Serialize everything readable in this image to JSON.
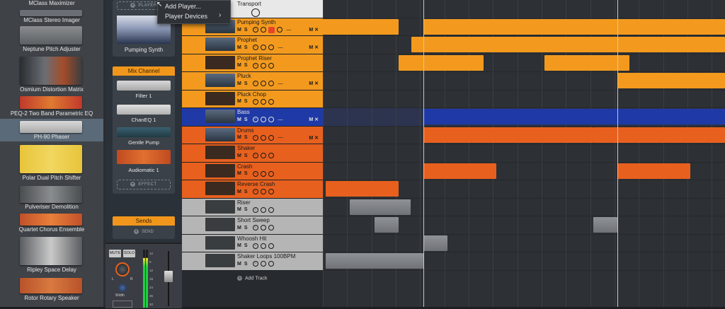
{
  "browser": {
    "devices": [
      {
        "label": "MClass Maximizer"
      },
      {
        "label": "MClass Stereo Imager"
      },
      {
        "label": "Neptune Pitch Adjuster"
      },
      {
        "label": "Osmium Distortion Matrix"
      },
      {
        "label": "PEQ-2 Two Band Parametric EQ"
      },
      {
        "label": "PH-90 Phaser"
      },
      {
        "label": "Polar Dual Pitch Shifter"
      },
      {
        "label": "Pulveriser Demolition"
      },
      {
        "label": "Quartet Chorus Ensemble"
      },
      {
        "label": "Ripley Space Delay"
      },
      {
        "label": "Rotor Rotary Speaker"
      }
    ]
  },
  "rack": {
    "player_label": "PLAYER",
    "instrument": "Pumping Synth",
    "mix_channel": {
      "title": "Mix Channel",
      "devices": [
        "Filter 1",
        "ChanEQ 1",
        "Gentle Pump",
        "Audiomatic 1"
      ]
    },
    "effect_label": "EFFECT",
    "sends": {
      "title": "Sends",
      "send_label": "SEND"
    },
    "mixer": {
      "mute": "MUTE",
      "solo": "SOLO",
      "width": "Width",
      "l": "L",
      "r": "R",
      "meter_scale": [
        "12",
        "0",
        "12",
        "18",
        "24",
        "36",
        "40"
      ]
    }
  },
  "context_menu": {
    "items": [
      "Add Player...",
      "Player Devices"
    ]
  },
  "tracks": {
    "controls": {
      "m": "M",
      "s": "S",
      "x": "✕",
      "dash": "—"
    },
    "add_track": "Add Track",
    "list": [
      {
        "name": "Transport",
        "color": "#e8e8e8"
      },
      {
        "name": "Pumping Synth",
        "color": "#f39a1e"
      },
      {
        "name": "Prophet",
        "color": "#f39a1e"
      },
      {
        "name": "Prophet Riser",
        "color": "#f39a1e"
      },
      {
        "name": "Pluck",
        "color": "#f39a1e"
      },
      {
        "name": "Pluck Chop",
        "color": "#f39a1e"
      },
      {
        "name": "Bass",
        "color": "#1f3aa6"
      },
      {
        "name": "Drums",
        "color": "#e8601e"
      },
      {
        "name": "Shaker",
        "color": "#e8601e"
      },
      {
        "name": "Crash",
        "color": "#e8601e"
      },
      {
        "name": "Reverse Crash",
        "color": "#e8601e"
      },
      {
        "name": "Riser",
        "color": "#b5b5b5"
      },
      {
        "name": "Short Sweep",
        "color": "#b5b5b5"
      },
      {
        "name": "Whoosh Hit",
        "color": "#b5b5b5"
      },
      {
        "name": "Shaker Loops 100BPM",
        "color": "#b5b5b5"
      }
    ]
  },
  "colors": {
    "orange": "#f39a1e",
    "dark_orange": "#e8601e",
    "blue": "#1f3aa6",
    "grey": "#b5b5b5",
    "accent": "#f0961c"
  }
}
